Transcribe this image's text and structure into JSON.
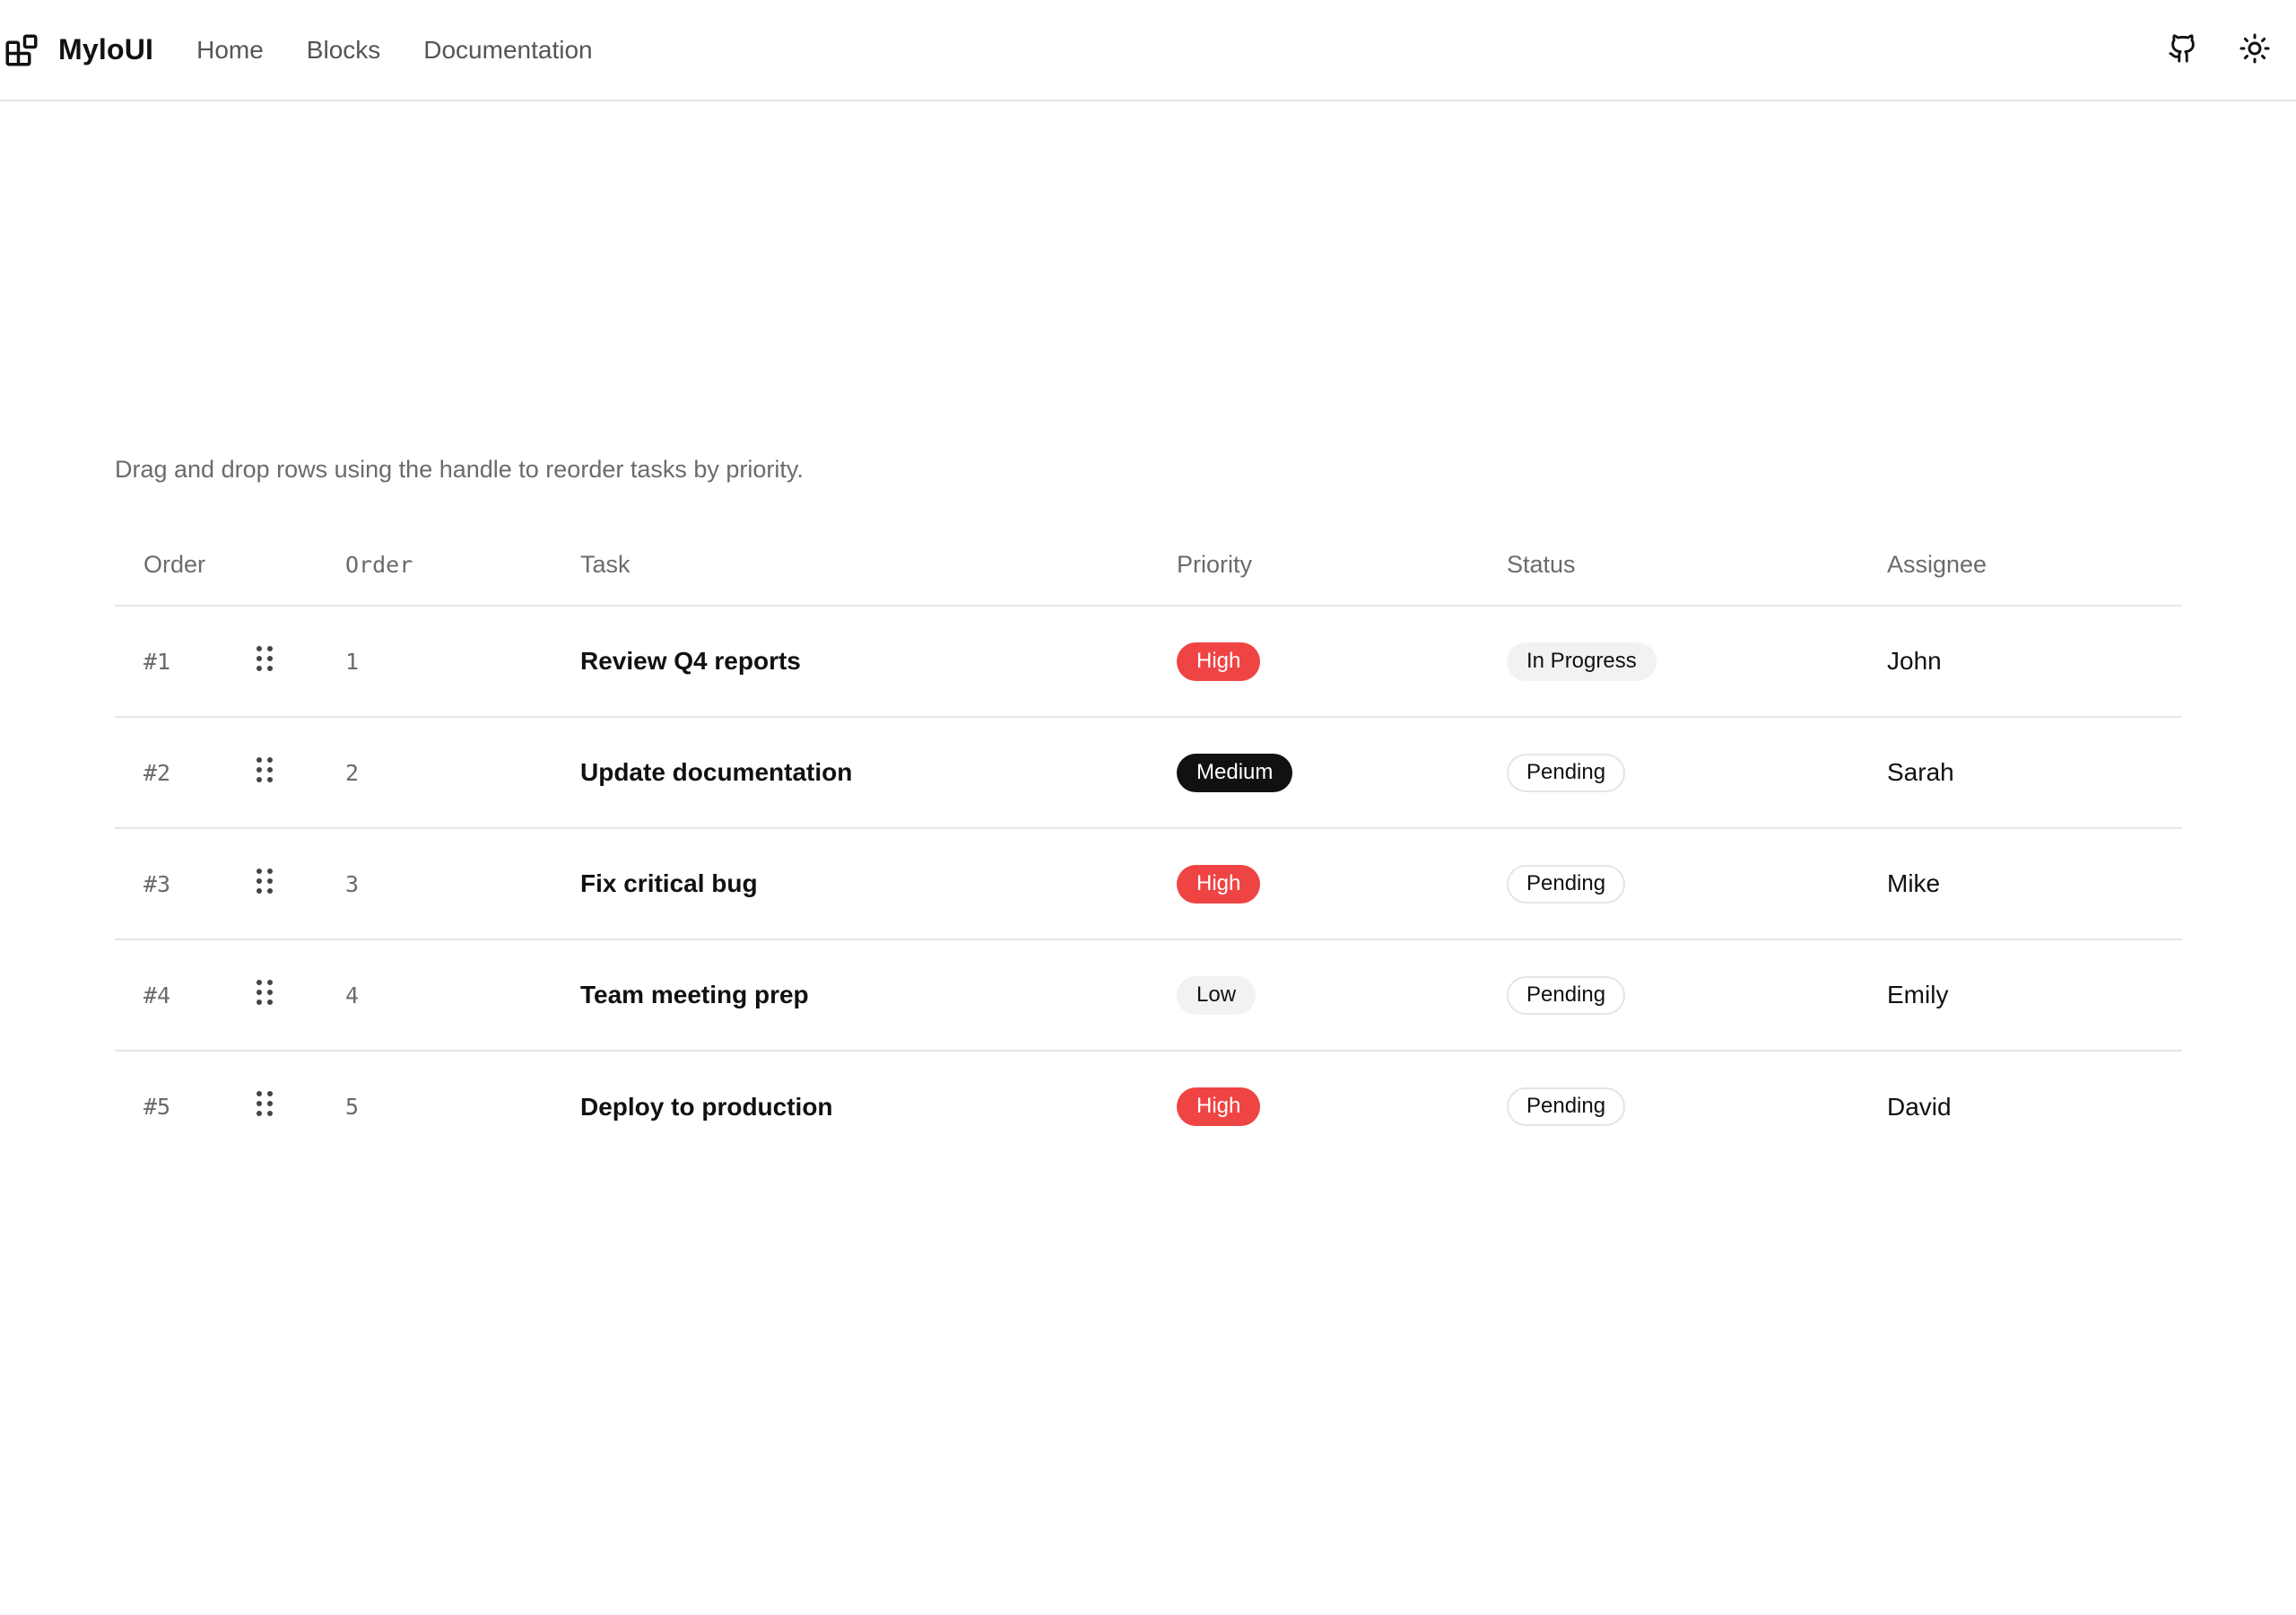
{
  "header": {
    "brand": "MyloUI",
    "nav": [
      "Home",
      "Blocks",
      "Documentation"
    ]
  },
  "description": "Drag and drop rows using the handle to reorder tasks by priority.",
  "table": {
    "columns": {
      "order": "Order",
      "order_mono": "Order",
      "task": "Task",
      "priority": "Priority",
      "status": "Status",
      "assignee": "Assignee"
    },
    "rows": [
      {
        "order": "#1",
        "num": "1",
        "task": "Review Q4 reports",
        "priority": "High",
        "status": "In Progress",
        "assignee": "John"
      },
      {
        "order": "#2",
        "num": "2",
        "task": "Update documentation",
        "priority": "Medium",
        "status": "Pending",
        "assignee": "Sarah"
      },
      {
        "order": "#3",
        "num": "3",
        "task": "Fix critical bug",
        "priority": "High",
        "status": "Pending",
        "assignee": "Mike"
      },
      {
        "order": "#4",
        "num": "4",
        "task": "Team meeting prep",
        "priority": "Low",
        "status": "Pending",
        "assignee": "Emily"
      },
      {
        "order": "#5",
        "num": "5",
        "task": "Deploy to production",
        "priority": "High",
        "status": "Pending",
        "assignee": "David"
      }
    ]
  },
  "colors": {
    "high": "#ef4444",
    "medium": "#111111",
    "low": "#f2f2f2",
    "border": "#e5e5e5",
    "muted_text": "#6b6b6b"
  },
  "icons": {
    "brand": "blocks-icon",
    "github": "github-icon",
    "theme": "sun-icon",
    "handle": "grip-vertical-icon"
  }
}
